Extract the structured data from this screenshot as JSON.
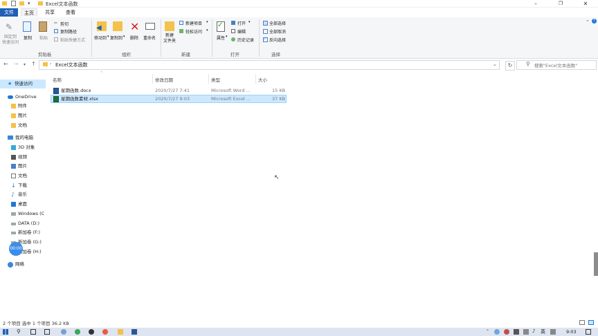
{
  "window": {
    "title": "Excel文本函数"
  },
  "tabs": {
    "file": "文件",
    "home": "主页",
    "share": "共享",
    "view": "查看"
  },
  "ribbon": {
    "clipboard": {
      "pin": "固定到\n快速访问",
      "copy": "复制",
      "paste": "粘贴",
      "cut": "剪切",
      "copy_path": "复制路径",
      "paste_shortcut": "粘贴快捷方式",
      "group": "剪贴板"
    },
    "organize": {
      "move_to": "移动到",
      "copy_to": "复制到",
      "delete": "删除",
      "rename": "重命名",
      "group": "组织"
    },
    "new": {
      "new_folder": "新建\n文件夹",
      "new_item": "新建项目",
      "easy_access": "轻松访问",
      "group": "新建"
    },
    "open": {
      "properties": "属性",
      "open": "打开",
      "edit": "编辑",
      "history": "历史记录",
      "group": "打开"
    },
    "select": {
      "select_all": "全部选择",
      "select_none": "全部取消",
      "invert": "反向选择",
      "group": "选择"
    }
  },
  "address": {
    "path": "Excel文本函数",
    "search_placeholder": "搜索\"Excel文本函数\""
  },
  "sidebar": {
    "quick_access": "快速访问",
    "onedrive": "OneDrive",
    "attachments": "附件",
    "pictures": "图片",
    "documents": "文档",
    "this_pc": "我的电脑",
    "objects3d": "3D 对象",
    "videos": "视频",
    "pictures2": "图片",
    "documents2": "文档",
    "downloads": "下载",
    "music": "音乐",
    "desktop": "桌面",
    "drive_c": "Windows (C",
    "drive_d": "DATA (D:)",
    "drive_f": "新加卷 (F:)",
    "drive_g": "新加卷 (G:)",
    "drive_h": "新加卷 (H:)",
    "network": "网络"
  },
  "columns": {
    "name": "名称",
    "modified": "修改日期",
    "type": "类型",
    "size": "大小"
  },
  "files": [
    {
      "name": "星期函数.docx",
      "modified": "2020/7/27 7:41",
      "type": "Microsoft Word ...",
      "size": "15 KB"
    },
    {
      "name": "星期函数素材.xlsx",
      "modified": "2020/7/27 9:03",
      "type": "Microsoft Excel ...",
      "size": "37 KB"
    }
  ],
  "status": {
    "text": "2 个项目   选中 1 个项目  36.2 KB"
  },
  "overlay": {
    "timer": "00:00"
  },
  "taskbar": {
    "ime": "英",
    "clock": "9:03"
  },
  "colors": {
    "accent": "#1f5fb6",
    "selection": "#cce8ff",
    "selection_border": "#99d1ff"
  }
}
